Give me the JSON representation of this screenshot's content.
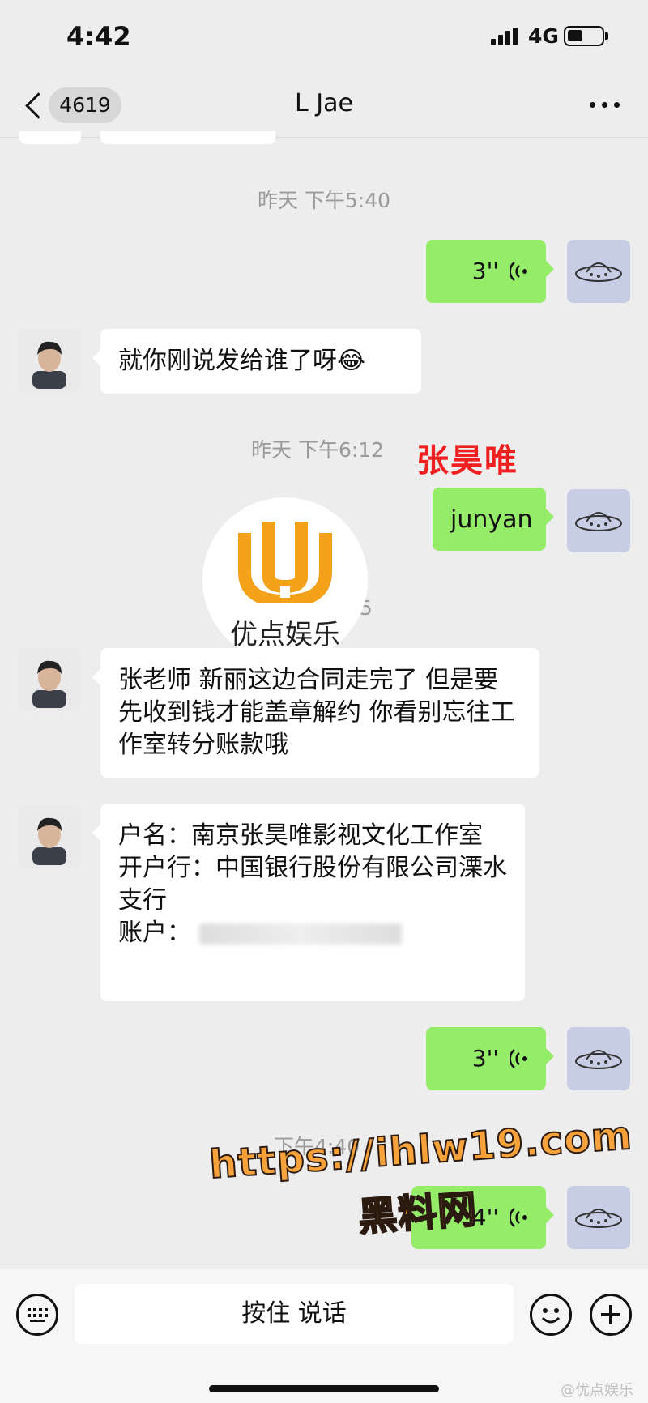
{
  "status_bar": {
    "time": "4:42",
    "network": "4G"
  },
  "header": {
    "back_badge": "4619",
    "title": "L Jae"
  },
  "messages": {
    "ts1": "昨天 下午5:40",
    "voice1": "3''",
    "msg1": "就你刚说发给谁了呀😂",
    "ts2": "昨天 下午6:12",
    "msg2": "junyan",
    "ts3_partial": "55",
    "msg3": "张老师 新丽这边合同走完了 但是要先收到钱才能盖章解约 你看别忘往工作室转分账款哦",
    "msg4_line1": "户名：南京张昊唯影视文化工作室",
    "msg4_line2": "开户行：中国银行股份有限公司溧水支行",
    "msg4_line3": "账户：",
    "voice2": "3''",
    "ts4": "下午4:40",
    "voice3": "4''"
  },
  "overlays": {
    "logo_text": "优点娱乐",
    "red_label": "张昊唯",
    "watermark_url": "https://ihlw19.com",
    "watermark_name": "黑料网",
    "corner_watermark": "@优点娱乐"
  },
  "input_bar": {
    "hold_to_talk": "按住 说话"
  },
  "colors": {
    "green_bubble": "#95ec69",
    "background": "#ededed",
    "logo_orange": "#f5a21b",
    "label_red": "#f02020"
  }
}
